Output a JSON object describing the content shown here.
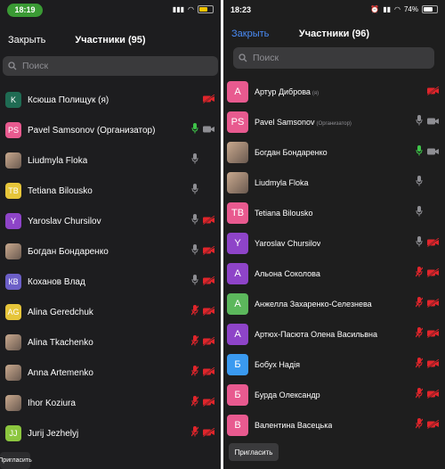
{
  "left": {
    "status": {
      "time": "18:19"
    },
    "header": {
      "close_label": "Закрыть",
      "title": "Участники (95)"
    },
    "search": {
      "placeholder": "Поиск"
    },
    "participants": [
      {
        "initial": "K",
        "name": "Ксюша Полищук (я)",
        "avatar_color": "#1f6b53",
        "photo": false,
        "mic": "none",
        "cam": "off"
      },
      {
        "initial": "PS",
        "name": "Pavel Samsonov (Организатор)",
        "avatar_color": "#e85a8f",
        "photo": false,
        "mic": "active",
        "cam": "on"
      },
      {
        "initial": "",
        "name": "Liudmyla Floka",
        "avatar_color": "#d8cfc6",
        "photo": true,
        "mic": "on",
        "cam": "none"
      },
      {
        "initial": "TB",
        "name": "Tetiana Bilousko",
        "avatar_color": "#e6c53a",
        "photo": false,
        "mic": "on",
        "cam": "none"
      },
      {
        "initial": "Y",
        "name": "Yaroslav Chursilov",
        "avatar_color": "#8e44c8",
        "photo": false,
        "mic": "on",
        "cam": "off"
      },
      {
        "initial": "",
        "name": "Богдан Бондаренко",
        "avatar_color": "#6a7f94",
        "photo": true,
        "mic": "on",
        "cam": "off"
      },
      {
        "initial": "КВ",
        "name": "Коханов Влад",
        "avatar_color": "#6c5fc7",
        "photo": false,
        "mic": "on",
        "cam": "off"
      },
      {
        "initial": "AG",
        "name": "Alina Geredchuk",
        "avatar_color": "#e6c53a",
        "photo": false,
        "mic": "off",
        "cam": "off"
      },
      {
        "initial": "",
        "name": "Alina Tkachenko",
        "avatar_color": "#8a94a3",
        "photo": true,
        "mic": "off",
        "cam": "off"
      },
      {
        "initial": "",
        "name": "Anna Artemenko",
        "avatar_color": "#b08a6b",
        "photo": true,
        "mic": "off",
        "cam": "off"
      },
      {
        "initial": "",
        "name": "Ihor Koziura",
        "avatar_color": "#6b6b6b",
        "photo": true,
        "mic": "off",
        "cam": "off"
      },
      {
        "initial": "JJ",
        "name": "Jurij Jezhelyj",
        "avatar_color": "#8cc63f",
        "photo": false,
        "mic": "off",
        "cam": "off"
      }
    ],
    "invite_label": "Пригласить"
  },
  "right": {
    "status": {
      "time": "18:23",
      "battery": "74%"
    },
    "header": {
      "close_label": "Закрыть",
      "title": "Участники (96)"
    },
    "search": {
      "placeholder": "Поиск"
    },
    "participants": [
      {
        "initial": "А",
        "name": "Артур Диброва",
        "role": "(я)",
        "avatar_color": "#e85a8f",
        "photo": false,
        "mic": "none",
        "cam": "off"
      },
      {
        "initial": "PS",
        "name": "Pavel Samsonov",
        "role": "(Организатор)",
        "avatar_color": "#e85a8f",
        "photo": false,
        "mic": "on",
        "cam": "on"
      },
      {
        "initial": "",
        "name": "Богдан Бондаренко",
        "role": "",
        "avatar_color": "#6a7f94",
        "photo": true,
        "mic": "active",
        "cam": "on"
      },
      {
        "initial": "",
        "name": "Liudmyla Floka",
        "role": "",
        "avatar_color": "#d8cfc6",
        "photo": true,
        "mic": "on",
        "cam": "none"
      },
      {
        "initial": "TB",
        "name": "Tetiana Bilousko",
        "role": "",
        "avatar_color": "#e85a8f",
        "photo": false,
        "mic": "on",
        "cam": "none"
      },
      {
        "initial": "Y",
        "name": "Yaroslav Chursilov",
        "role": "",
        "avatar_color": "#8e44c8",
        "photo": false,
        "mic": "on",
        "cam": "off"
      },
      {
        "initial": "А",
        "name": "Альона Соколова",
        "role": "",
        "avatar_color": "#8e44c8",
        "photo": false,
        "mic": "off",
        "cam": "off"
      },
      {
        "initial": "А",
        "name": "Анжелла Захаренко-Селезнева",
        "role": "",
        "avatar_color": "#5cb85c",
        "photo": false,
        "mic": "off",
        "cam": "off"
      },
      {
        "initial": "А",
        "name": "Артюх-Пасюта Олена Васильвна",
        "role": "",
        "avatar_color": "#8e44c8",
        "photo": false,
        "mic": "off",
        "cam": "off"
      },
      {
        "initial": "Б",
        "name": "Бобух Надія",
        "role": "",
        "avatar_color": "#3a9af0",
        "photo": false,
        "mic": "off",
        "cam": "off"
      },
      {
        "initial": "Б",
        "name": "Бурда Олександр",
        "role": "",
        "avatar_color": "#e85a8f",
        "photo": false,
        "mic": "off",
        "cam": "off"
      },
      {
        "initial": "В",
        "name": "Валентина Васецька",
        "role": "",
        "avatar_color": "#e85a8f",
        "photo": false,
        "mic": "off",
        "cam": "off"
      }
    ],
    "invite_label": "Пригласить"
  },
  "colors": {
    "red": "#e0252b",
    "green": "#3ec449",
    "gray": "#8e8e93"
  }
}
